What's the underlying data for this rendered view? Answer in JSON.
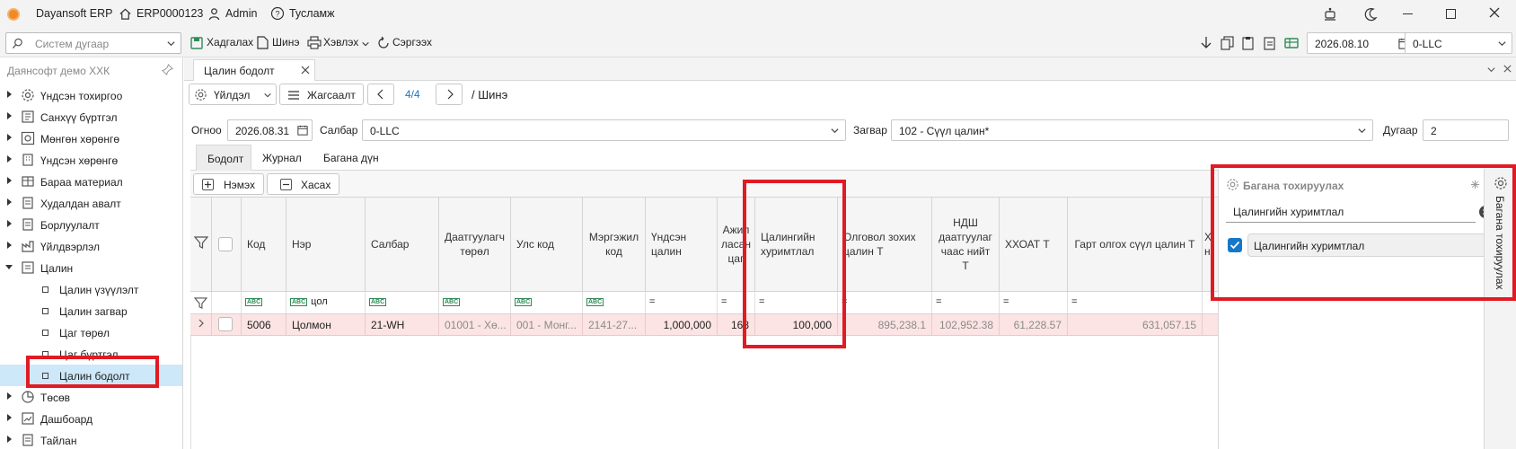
{
  "titlebar": {
    "app_name": "Dayansoft ERP",
    "doc_code": "ERP0000123",
    "user": "Admin",
    "help": "Тусламж"
  },
  "toolbar": {
    "search_placeholder": "Систем дугаар",
    "save": "Хадгалах",
    "new": "Шинэ",
    "print": "Хэвлэх",
    "refresh": "Сэргээх",
    "date": "2026.08.10",
    "branch": "0-LLC"
  },
  "sidebar": {
    "company": "Даянсофт демо ХХК",
    "items": [
      {
        "label": "Үндсэн тохиргоо"
      },
      {
        "label": "Санхүү бүртгэл"
      },
      {
        "label": "Мөнгөн хөрөнгө"
      },
      {
        "label": "Үндсэн хөрөнгө"
      },
      {
        "label": "Бараа материал"
      },
      {
        "label": "Худалдан авалт"
      },
      {
        "label": "Борлуулалт"
      },
      {
        "label": "Үйлдвэрлэл"
      },
      {
        "label": "Цалин"
      }
    ],
    "sub_items": [
      {
        "label": "Цалин үзүүлэлт"
      },
      {
        "label": "Цалин загвар"
      },
      {
        "label": "Цаг төрөл"
      },
      {
        "label": "Цаг бүртгэл"
      },
      {
        "label": "Цалин бодолт"
      }
    ],
    "bottom_items": [
      {
        "label": "Төсөв"
      },
      {
        "label": "Дашбоард"
      },
      {
        "label": "Тайлан"
      }
    ]
  },
  "doc_tab": {
    "label": "Цалин бодолт"
  },
  "actions": {
    "actions_label": "Үйлдэл",
    "list_label": "Жагсаалт",
    "page": "4/4",
    "state": "/ Шинэ"
  },
  "form": {
    "date_label": "Огноо",
    "date_value": "2026.08.31",
    "branch_label": "Салбар",
    "branch_value": "0-LLC",
    "template_label": "Загвар",
    "template_value": "102 - Сүүл цалин*",
    "number_label": "Дугаар",
    "number_value": "2"
  },
  "subtabs": [
    "Бодолт",
    "Журнал",
    "Багана дүн"
  ],
  "grid_buttons": {
    "add": "Нэмэх",
    "remove": "Хасах"
  },
  "columns": [
    "Код",
    "Нэр",
    "Салбар",
    "Даатгуулагч төрөл",
    "Улс код",
    "Мэргэжил код",
    "Үндсэн цалин",
    "Ажил ласан цаг",
    "Цалингийн хуримтлал",
    "Олговол зохих цалин Т",
    "НДШ даатгуулаг чаас нийт Т",
    "ХХОАТ Т",
    "Гарт олгох сүүл цалин Т",
    "Х н"
  ],
  "filter": {
    "name_value": "цол",
    "eq": "="
  },
  "row": {
    "code": "5006",
    "name": "Цолмон",
    "branch": "21-WH",
    "insured_type": "01001 - Хө...",
    "country": "001 - Монг...",
    "profession": "2141-27...",
    "base_salary": "1,000,000",
    "hours": "168",
    "accumulation": "100,000",
    "payable": "895,238.1",
    "social_insurance": "102,952.38",
    "income_tax": "61,228.57",
    "net_pay": "631,057.15"
  },
  "column_panel": {
    "title": "Багана тохируулах",
    "search_value": "Цалингийн хуримтлал",
    "option": "Цалингийн хуримтлал",
    "side_tab": "Багана тохируулах"
  },
  "colors": {
    "accent": "#1677c8",
    "highlight_row": "#fce4e4",
    "annotation": "#e01b24"
  }
}
